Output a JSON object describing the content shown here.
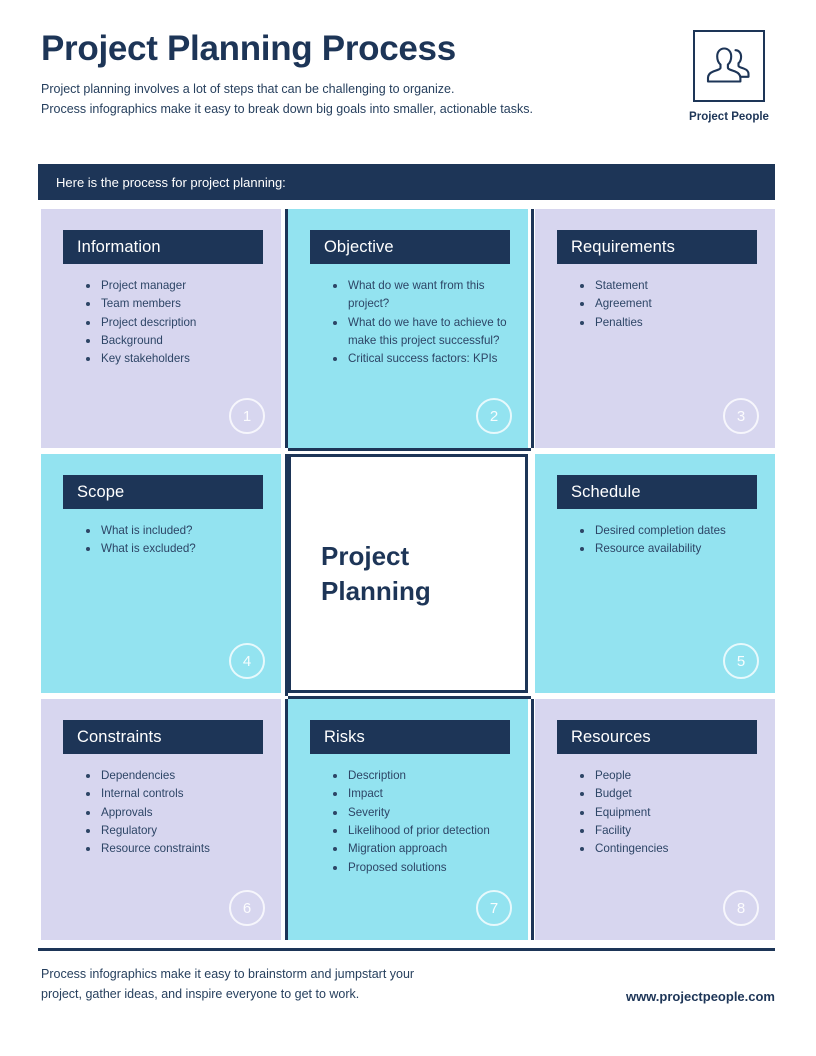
{
  "header": {
    "title": "Project Planning Process",
    "subtitle_line1": "Project planning involves a lot of steps that can be challenging to organize.",
    "subtitle_line2": "Process infographics make it easy to break down big goals into smaller, actionable tasks.",
    "logo_caption": "Project People",
    "logo_icon": "two-people-icon"
  },
  "banner": {
    "text": "Here is the process for project planning:"
  },
  "center": {
    "line1": "Project",
    "line2": "Planning"
  },
  "cards": [
    {
      "number": "1",
      "title": "Information",
      "theme": "lavender",
      "items": [
        "Project manager",
        "Team members",
        "Project description",
        "Background",
        "Key stakeholders"
      ]
    },
    {
      "number": "2",
      "title": "Objective",
      "theme": "cyan",
      "items": [
        "What do we want from this project?",
        "What do we have to achieve to make this project successful?",
        "Critical success factors: KPIs"
      ]
    },
    {
      "number": "3",
      "title": "Requirements",
      "theme": "lavender",
      "items": [
        "Statement",
        "Agreement",
        "Penalties"
      ]
    },
    {
      "number": "4",
      "title": "Scope",
      "theme": "cyan",
      "items": [
        "What is included?",
        "What is excluded?"
      ]
    },
    {
      "number": "5",
      "title": "Schedule",
      "theme": "cyan",
      "items": [
        "Desired completion dates",
        "Resource availability"
      ]
    },
    {
      "number": "6",
      "title": "Constraints",
      "theme": "lavender",
      "items": [
        "Dependencies",
        "Internal controls",
        "Approvals",
        "Regulatory",
        "Resource constraints"
      ]
    },
    {
      "number": "7",
      "title": "Risks",
      "theme": "cyan",
      "items": [
        "Description",
        "Impact",
        "Severity",
        "Likelihood of prior detection",
        "Migration approach",
        "Proposed solutions"
      ]
    },
    {
      "number": "8",
      "title": "Resources",
      "theme": "lavender",
      "items": [
        "People",
        "Budget",
        "Equipment",
        "Facility",
        "Contingencies"
      ]
    }
  ],
  "footer": {
    "text_line1": "Process infographics make it easy to brainstorm and jumpstart your",
    "text_line2": "project, gather ideas, and inspire everyone to get to work.",
    "url": "www.projectpeople.com"
  },
  "colors": {
    "navy": "#1d3557",
    "lavender": "#d7d6ef",
    "cyan": "#93e3f0",
    "white": "#ffffff",
    "body_text": "#2d4566"
  }
}
